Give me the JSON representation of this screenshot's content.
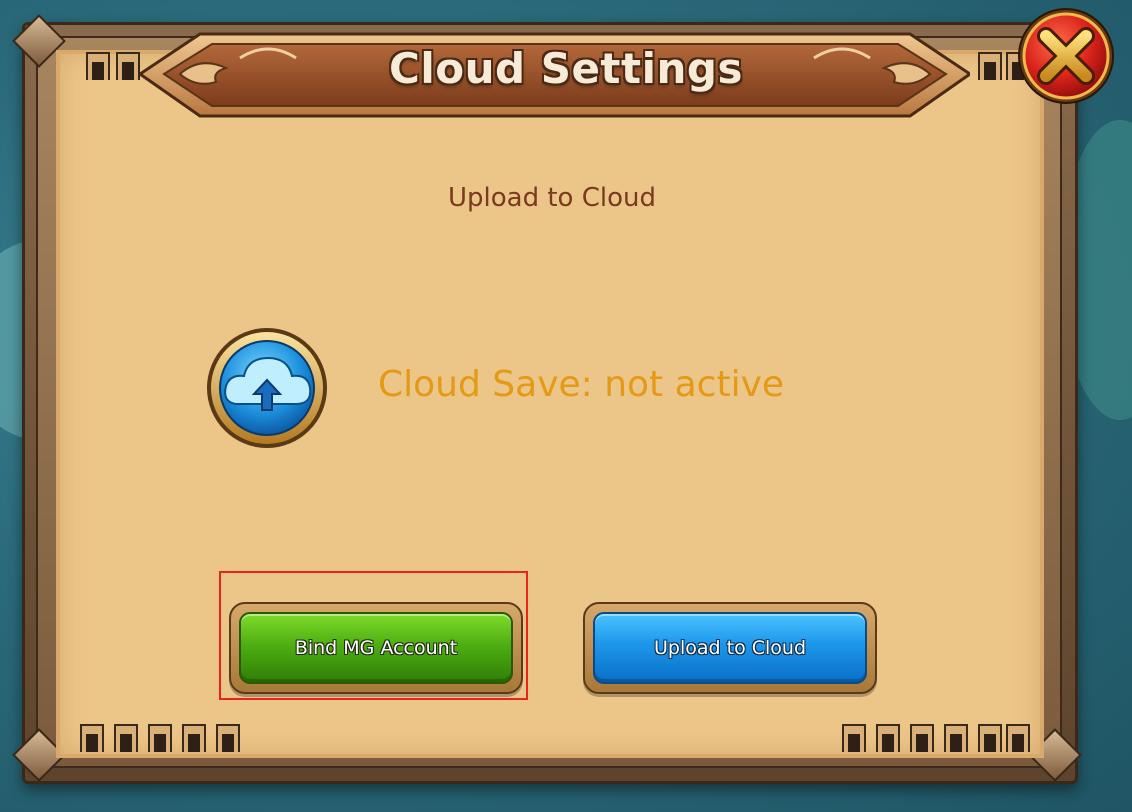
{
  "dialog": {
    "title": "Cloud Settings",
    "subtitle": "Upload to Cloud",
    "status_text": "Cloud Save: not active",
    "close_icon": "close-x-icon",
    "status_icon": "cloud-upload-icon"
  },
  "buttons": {
    "bind_label": "Bind MG Account",
    "upload_label": "Upload to Cloud"
  },
  "colors": {
    "parchment": "#ecc589",
    "status_text": "#e49a14",
    "subtitle": "#7a3a1e",
    "bind_button": "#4fae12",
    "upload_button": "#1d96ea",
    "close_button": "#d8201a",
    "highlight": "#e8241c"
  }
}
